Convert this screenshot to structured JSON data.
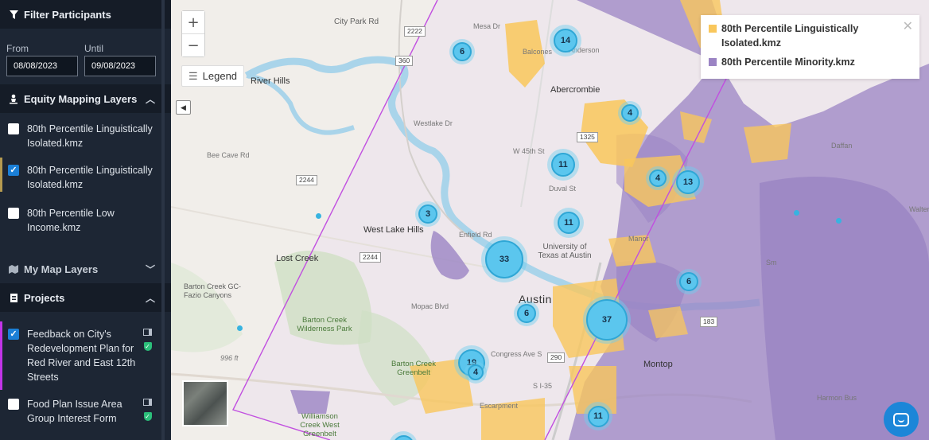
{
  "sidebar": {
    "filter": {
      "title": "Filter Participants",
      "from_label": "From",
      "until_label": "Until",
      "from_value": "08/08/2023",
      "until_value": "09/08/2023"
    },
    "equity": {
      "title": "Equity Mapping Layers",
      "items": [
        {
          "label": "80th Percentile Linguistically Isolated.kmz",
          "checked": false
        },
        {
          "label": "80th Percentile Linguistically Isolated.kmz",
          "checked": true
        },
        {
          "label": "80th Percentile Low Income.kmz",
          "checked": false
        }
      ]
    },
    "my_layers": {
      "title": "My Map Layers"
    },
    "projects": {
      "title": "Projects",
      "items": [
        {
          "label": "Feedback on City's Redevelopment Plan for Red River and East 12th Streets",
          "checked": true
        },
        {
          "label": "Food Plan Issue Area Group Interest Form",
          "checked": false
        }
      ]
    }
  },
  "map": {
    "controls": {
      "zoom_in": "+",
      "zoom_out": "−",
      "legend_label": "Legend",
      "collapse_icon": "◀"
    },
    "legend": {
      "close": "✕",
      "items": [
        {
          "label": "80th Percentile Linguistically Isolated.kmz",
          "color": "#f9c75c"
        },
        {
          "label": "80th Percentile Minority.kmz",
          "color": "#9b84c4"
        }
      ]
    },
    "clusters": [
      "6",
      "14",
      "4",
      "11",
      "4",
      "13",
      "3",
      "11",
      "33",
      "6",
      "6",
      "37",
      "19",
      "4",
      "11"
    ],
    "labels": {
      "city_park_rd": "City Park Rd",
      "river_hills": "River Hills",
      "mesa_dr": "Mesa Dr",
      "balcones": "Balcones",
      "escarpment": "Escarp",
      "anderson": "Anderson",
      "abercrombie": "Abercrombie",
      "westlake_dr": "Westlake Dr",
      "w45": "W 45th St",
      "duval": "Duval St",
      "bee_cave": "Bee Cave Rd",
      "west_lake_hills": "West Lake Hills",
      "enfield": "Enfield Rd",
      "ut": "University of Texas at Austin",
      "manor": "Manor",
      "lost_creek": "Lost Creek",
      "bc_fazio": "Barton Creek GC-Fazio Canyons",
      "mopac": "Mopac Blvd",
      "austin": "Austin",
      "bc_wilderness": "Barton Creek Wilderness Park",
      "bc_greenbelt": "Barton Creek Greenbelt",
      "congress": "Congress Ave S",
      "ih35": "S I-35",
      "montopolis": "Montop",
      "elev": "996 ft",
      "williamson": "Williamson Creek West Greenbelt",
      "escarpment2": "Escarpment",
      "walter": "Walter Metr",
      "dessau": "Daffan",
      "smith": "Sm",
      "harmon": "Harmon Bus",
      "shield_2222": "2222",
      "shield_360": "360",
      "shield_2244a": "2244",
      "shield_2244b": "2244",
      "shield_290": "290",
      "shield_183": "183",
      "shield_1": "1",
      "shield_ihwy": "1H-35",
      "shield_1325": "1325"
    }
  }
}
